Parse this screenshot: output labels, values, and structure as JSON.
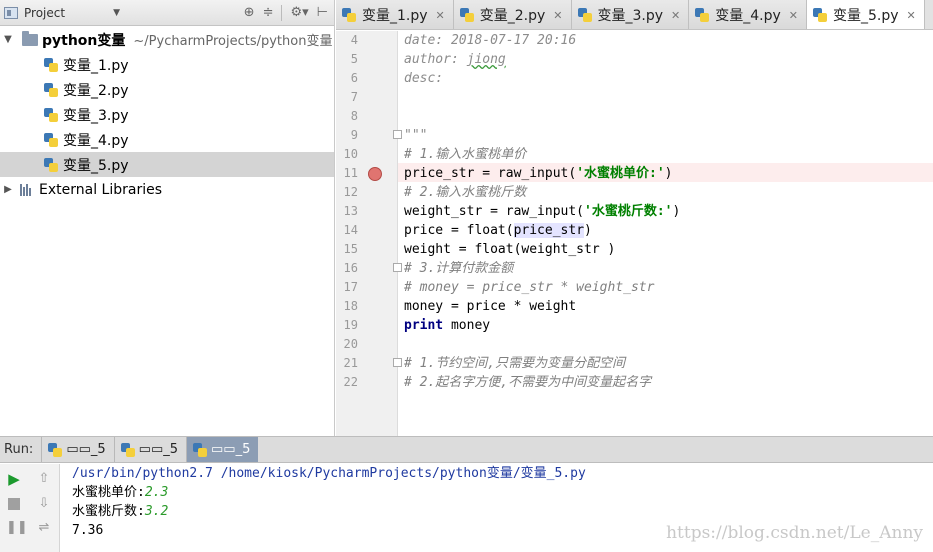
{
  "project_panel": {
    "title": "Project",
    "root_folder": "python变量",
    "root_path": "~/PycharmProjects/python变量",
    "files": [
      "变量_1.py",
      "变量_2.py",
      "变量_3.py",
      "变量_4.py",
      "变量_5.py"
    ],
    "selected_file": "变量_5.py",
    "external_libraries": "External Libraries"
  },
  "editor_tabs": [
    {
      "label": "变量_1.py",
      "active": false
    },
    {
      "label": "变量_2.py",
      "active": false
    },
    {
      "label": "变量_3.py",
      "active": false
    },
    {
      "label": "变量_4.py",
      "active": false
    },
    {
      "label": "变量_5.py",
      "active": true
    }
  ],
  "editor": {
    "line_numbers": [
      "4",
      "5",
      "6",
      "7",
      "8",
      "9",
      "10",
      "11",
      "12",
      "13",
      "14",
      "15",
      "16",
      "17",
      "18",
      "19",
      "20",
      "21",
      "22"
    ],
    "breakpoint_line": "11",
    "code": {
      "l4": "date: 2018-07-17 20:16",
      "l5_key": "author: ",
      "l5_val": "jiong",
      "l6": "desc:",
      "l9": "\"\"\"",
      "l10": "# 1.输入水蜜桃单价",
      "l11_a": "price_str = raw_input(",
      "l11_str": "'水蜜桃单价:'",
      "l11_b": ")",
      "l12": "# 2.输入水蜜桃斤数",
      "l13_a": "weight_str = raw_input(",
      "l13_str": "'水蜜桃斤数:'",
      "l13_b": ")",
      "l14_a": "price = float(",
      "l14_usage": "price_str",
      "l14_b": ")",
      "l15": "weight = float(weight_str )",
      "l16": "# 3.计算付款金额",
      "l17": "# money = price_str * weight_str",
      "l18": "money = price * weight",
      "l19_kw": "print",
      "l19_rest": " money",
      "l21": "# 1.节约空间,只需要为变量分配空间",
      "l22": "# 2.起名字方便,不需要为中间变量起名字"
    }
  },
  "run_panel": {
    "label": "Run:",
    "tabs": [
      "▭▭_5",
      "▭▭_5",
      "▭▭_5"
    ],
    "active_tab": 2,
    "console": {
      "command": "/usr/bin/python2.7 /home/kiosk/PycharmProjects/python变量/变量_5.py",
      "prompt1": "水蜜桃单价:",
      "input1": "2.3",
      "prompt2": "水蜜桃斤数:",
      "input2": "3.2",
      "result": "7.36"
    },
    "watermark": "https://blog.csdn.net/Le_Anny"
  },
  "icons": [
    "project-icon",
    "locate-icon",
    "collapse-icon",
    "gear-icon",
    "hide-icon",
    "folder-icon",
    "python-file-icon",
    "library-icon",
    "breakpoint-icon",
    "run-icon",
    "stop-icon",
    "up-icon",
    "down-icon",
    "pause-icon"
  ],
  "colors": {
    "comment": "#808080",
    "string": "#008000",
    "keyword": "#000080",
    "breakpoint": "#e07470",
    "run_tab_active": "#8c9db4"
  }
}
